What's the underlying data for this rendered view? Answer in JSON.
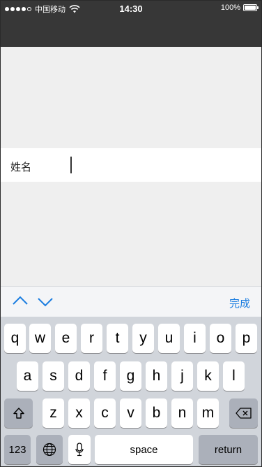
{
  "status_bar": {
    "carrier": "中国移动",
    "time": "14:30",
    "battery": "100%"
  },
  "form": {
    "name_label": "姓名",
    "name_value": ""
  },
  "accessory": {
    "done_label": "完成"
  },
  "keyboard": {
    "row1": [
      "q",
      "w",
      "e",
      "r",
      "t",
      "y",
      "u",
      "i",
      "o",
      "p"
    ],
    "row2": [
      "a",
      "s",
      "d",
      "f",
      "g",
      "h",
      "j",
      "k",
      "l"
    ],
    "row3": [
      "z",
      "x",
      "c",
      "v",
      "b",
      "n",
      "m"
    ],
    "num_label": "123",
    "space_label": "space",
    "return_label": "return"
  },
  "colors": {
    "nav_bg": "#373737",
    "accent": "#1a7de0",
    "page_bg": "#efefef",
    "keyboard_bg": "#d1d5db"
  }
}
